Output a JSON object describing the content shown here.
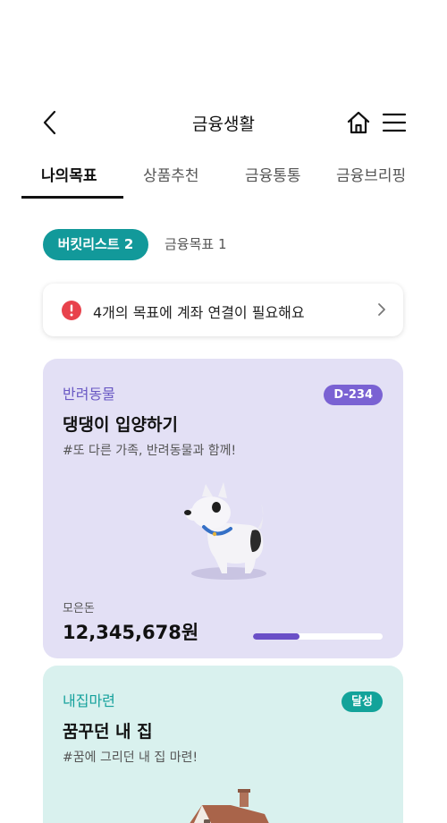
{
  "header": {
    "title": "금융생활",
    "back_icon": "chevron-left-icon",
    "home_icon": "home-icon",
    "menu_icon": "hamburger-menu-icon"
  },
  "tabs": [
    {
      "label": "나의목표",
      "active": true
    },
    {
      "label": "상품추천",
      "active": false
    },
    {
      "label": "금융통통",
      "active": false
    },
    {
      "label": "금융브리핑",
      "active": false
    }
  ],
  "filters": {
    "bucket_list": "버킷리스트 2",
    "financial_goals": "금융목표 1"
  },
  "notice": {
    "icon": "info-icon",
    "text": "4개의 목표에 계좌 연결이 필요해요"
  },
  "goals": [
    {
      "category": "반려동물",
      "badge": "D-234",
      "title": "댕댕이 입양하기",
      "description": "#또 다른 가족, 반려동물과 함께!",
      "saved_label": "모은돈",
      "saved_amount": "12,345,678원",
      "progress": 0.36,
      "color": "#6a59c4"
    },
    {
      "category": "내집마련",
      "badge": "달성",
      "title": "꿈꾸던 내 집",
      "description": "#꿈에 그리던 내 집 마련!",
      "color": "#15a19c"
    }
  ]
}
